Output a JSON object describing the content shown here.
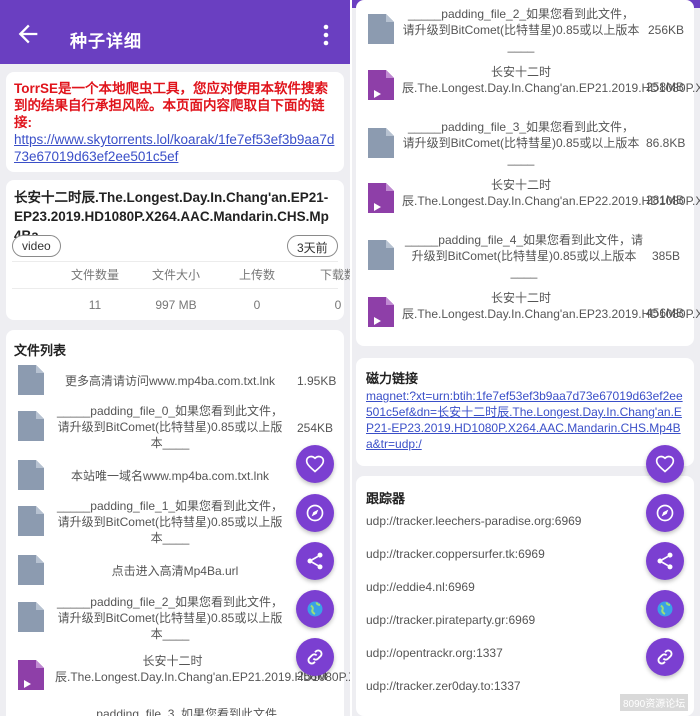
{
  "header": {
    "title": "种子详细"
  },
  "warning": {
    "text": "TorrSE是一个本地爬虫工具，您应对使用本软件搜索到的结果自行承担风险。本页面内容爬取自下面的链接:",
    "link": "https://www.skytorrents.lol/koarak/1fe7ef53ef3b9aa7d73e67019d63ef2ee501c5ef"
  },
  "torrent": {
    "name": "长安十二时辰.The.Longest.Day.In.Chang'an.EP21-EP23.2019.HD1080P.X264.AAC.Mandarin.CHS.Mp4Ba",
    "category": "video",
    "age": "3天前",
    "stats": [
      {
        "label": "文件数量",
        "value": "11"
      },
      {
        "label": "文件大小",
        "value": "997 MB"
      },
      {
        "label": "上传数",
        "value": "0"
      },
      {
        "label": "下载数",
        "value": "0"
      }
    ]
  },
  "files_left": {
    "title": "文件列表",
    "items": [
      {
        "name": "更多高清请访问www.mp4ba.com.txt.lnk",
        "size": "1.95KB",
        "type": "doc"
      },
      {
        "name": "_____padding_file_0_如果您看到此文件，请升级到BitComet(比特彗星)0.85或以上版本____",
        "size": "254KB",
        "type": "doc"
      },
      {
        "name": "本站唯一域名www.mp4ba.com.txt.lnk",
        "size": "1.9",
        "type": "doc"
      },
      {
        "name": "_____padding_file_1_如果您看到此文件，请升级到BitComet(比特彗星)0.85或以上版本____",
        "size": "2",
        "type": "doc"
      },
      {
        "name": "点击进入高清Mp4Ba.url",
        "size": "",
        "type": "doc"
      },
      {
        "name": "_____padding_file_2_如果您看到此文件，请升级到BitComet(比特彗星)0.85或以上版本____",
        "size": "",
        "type": "doc"
      },
      {
        "name": "长安十二时辰.The.Longest.Day.In.Chang'an.EP21.2019.HD1080P.X264.AAC.Mandarin.CHS.Mp4Ba.mp4",
        "size": "258M",
        "type": "video"
      },
      {
        "name": "_____padding_file_3_如果您看到此文件",
        "size": "",
        "type": "doc"
      }
    ]
  },
  "files_right": [
    {
      "name": "_____padding_file_2_如果您看到此文件，请升级到BitComet(比特彗星)0.85或以上版本____",
      "size": "256KB",
      "type": "doc"
    },
    {
      "name": "长安十二时辰.The.Longest.Day.In.Chang'an.EP21.2019.HD1080P.X264.AAC.Mandarin.CHS.Mp4Ba.mp4",
      "size": "258MB",
      "type": "video"
    },
    {
      "name": "_____padding_file_3_如果您看到此文件，请升级到BitComet(比特彗星)0.85或以上版本____",
      "size": "86.8KB",
      "type": "doc"
    },
    {
      "name": "长安十二时辰.The.Longest.Day.In.Chang'an.EP22.2019.HD1080P.X264.AAC.Mandarin.CHS.Mp4Ba.mp4",
      "size": "281MB",
      "type": "video"
    },
    {
      "name": "_____padding_file_4_如果您看到此文件，请升级到BitComet(比特彗星)0.85或以上版本____",
      "size": "385B",
      "type": "doc"
    },
    {
      "name": "长安十二时辰.The.Longest.Day.In.Chang'an.EP23.2019.HD1080P.X264.AAC.Mandarin.CHS.Mp4Ba.mp4",
      "size": "456MB",
      "type": "video"
    }
  ],
  "magnet": {
    "title": "磁力链接",
    "link": "magnet:?xt=urn:btih:1fe7ef53ef3b9aa7d73e67019d63ef2ee501c5ef&dn=长安十二时辰.The.Longest.Day.In.Chang'an.EP21-EP23.2019.HD1080P.X264.AAC.Mandarin.CHS.Mp4Ba&tr=udp:/"
  },
  "trackers": {
    "title": "跟踪器",
    "items": [
      "udp://tracker.leechers-paradise.org:6969",
      "udp://tracker.coppersurfer.tk:6969",
      "udp://eddie4.nl:6969",
      "udp://tracker.pirateparty.gr:6969",
      "udp://opentrackr.org:1337",
      "udp://tracker.zer0day.to:1337"
    ]
  },
  "fabs": [
    "heart-icon",
    "compass-icon",
    "share-icon",
    "globe-icon",
    "link-icon"
  ],
  "colors": {
    "primary": "#6a3fc1",
    "fab": "#7b3fd1",
    "warning": "#e0141c",
    "link": "#3a4fc8",
    "file_icon": "#8c9bb0",
    "video_icon": "#8e3fa8"
  },
  "watermark": "8090资源论坛"
}
